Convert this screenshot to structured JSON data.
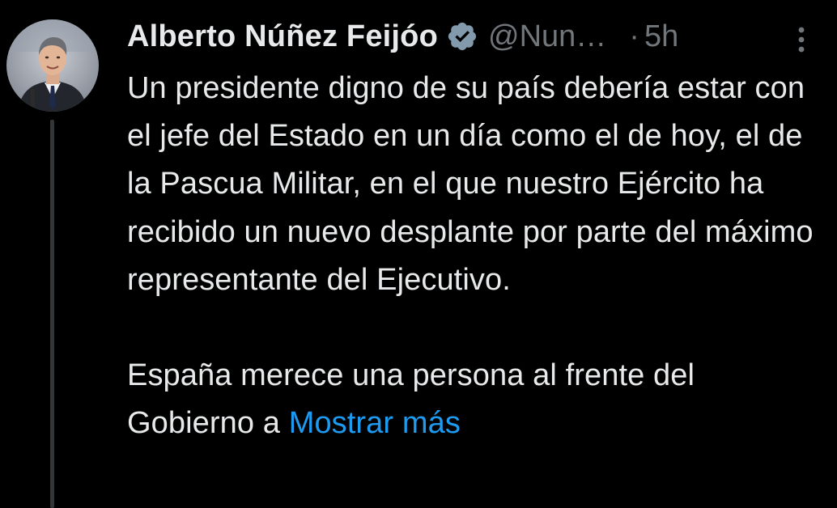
{
  "tweet": {
    "author_name": "Alberto Núñez Feijóo",
    "handle": "@Nun…",
    "separator": "·",
    "timestamp": "5h",
    "paragraphs": [
      "Un presidente digno de su país debería estar con el jefe del Estado en un día como el de hoy, el de la Pascua Militar, en el que nuestro Ejército ha recibido un nuevo desplante por parte del máximo representante del Ejecutivo.",
      "España merece una persona al frente del Gobierno a"
    ],
    "show_more_label": "Mostrar más",
    "icons": {
      "verified": "verified-badge-icon",
      "more": "more-options-icon"
    }
  },
  "colors": {
    "background": "#000000",
    "primary_text": "#e7e9ea",
    "secondary_text": "#71767b",
    "link": "#1d9bf0",
    "thread_line": "#333639"
  }
}
